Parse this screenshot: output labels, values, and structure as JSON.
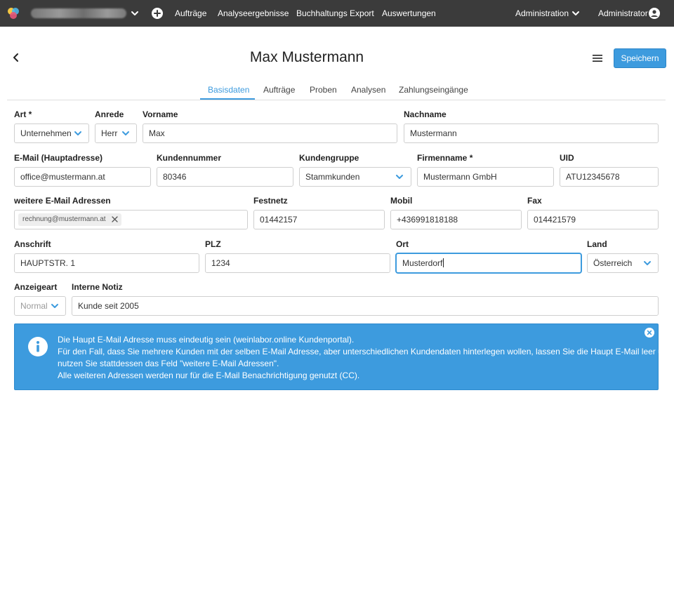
{
  "nav": {
    "links": [
      "Aufträge",
      "Analyseergebnisse",
      "Buchhaltungs Export",
      "Auswertungen"
    ],
    "admin_menu": "Administration",
    "user_menu": "Administrator"
  },
  "header": {
    "title": "Max Mustermann",
    "save_label": "Speichern"
  },
  "tabs": [
    "Basisdaten",
    "Aufträge",
    "Proben",
    "Analysen",
    "Zahlungseingänge"
  ],
  "form": {
    "art": {
      "label": "Art *",
      "value": "Unternehmen"
    },
    "anrede": {
      "label": "Anrede",
      "value": "Herr"
    },
    "vorname": {
      "label": "Vorname",
      "value": "Max"
    },
    "nachname": {
      "label": "Nachname",
      "value": "Mustermann"
    },
    "email": {
      "label": "E-Mail (Hauptadresse)",
      "value": "office@mustermann.at"
    },
    "kundennummer": {
      "label": "Kundennummer",
      "value": "80346"
    },
    "kundengruppe": {
      "label": "Kundengruppe",
      "value": "Stammkunden"
    },
    "firmenname": {
      "label": "Firmenname *",
      "value": "Mustermann GmbH"
    },
    "uid": {
      "label": "UID",
      "value": "ATU12345678"
    },
    "weitere_emails": {
      "label": "weitere E-Mail Adressen",
      "chips": [
        "rechnung@mustermann.at"
      ]
    },
    "festnetz": {
      "label": "Festnetz",
      "value": "01442157"
    },
    "mobil": {
      "label": "Mobil",
      "value": "+436991818188"
    },
    "fax": {
      "label": "Fax",
      "value": "014421579"
    },
    "anschrift": {
      "label": "Anschrift",
      "value": "HAUPTSTR. 1"
    },
    "plz": {
      "label": "PLZ",
      "value": "1234"
    },
    "ort": {
      "label": "Ort",
      "value": "Musterdorf"
    },
    "land": {
      "label": "Land",
      "value": "Österreich"
    },
    "anzeigeart": {
      "label": "Anzeigeart",
      "value": "Normal"
    },
    "interne_notiz": {
      "label": "Interne Notiz",
      "value": "Kunde seit 2005"
    }
  },
  "alert": {
    "lines": [
      "Die Haupt E-Mail Adresse muss eindeutig sein (weinlabor.online Kundenportal).",
      "Für den Fall, dass Sie mehrere Kunden mit der selben E-Mail Adresse, aber unterschiedlichen Kundendaten hinterlegen wollen, lassen Sie die Haupt E-Mail leer und",
      "nutzen Sie stattdessen das Feld \"weitere E-Mail Adressen\".",
      "Alle weiteren Adressen werden nur für die E-Mail Benachrichtigung genutzt (CC)."
    ]
  },
  "icons": {
    "logo": "app-logo",
    "org_switch": "chevron-down-icon",
    "create": "plus-circle-icon",
    "user": "user-circle-icon",
    "back": "chevron-left-icon",
    "menu": "hamburger-icon",
    "info": "info-circle-icon",
    "close": "close-icon"
  },
  "colors": {
    "navbar": "#3b3b3b",
    "accent": "#3d9bde",
    "border": "#cfcfcf"
  }
}
